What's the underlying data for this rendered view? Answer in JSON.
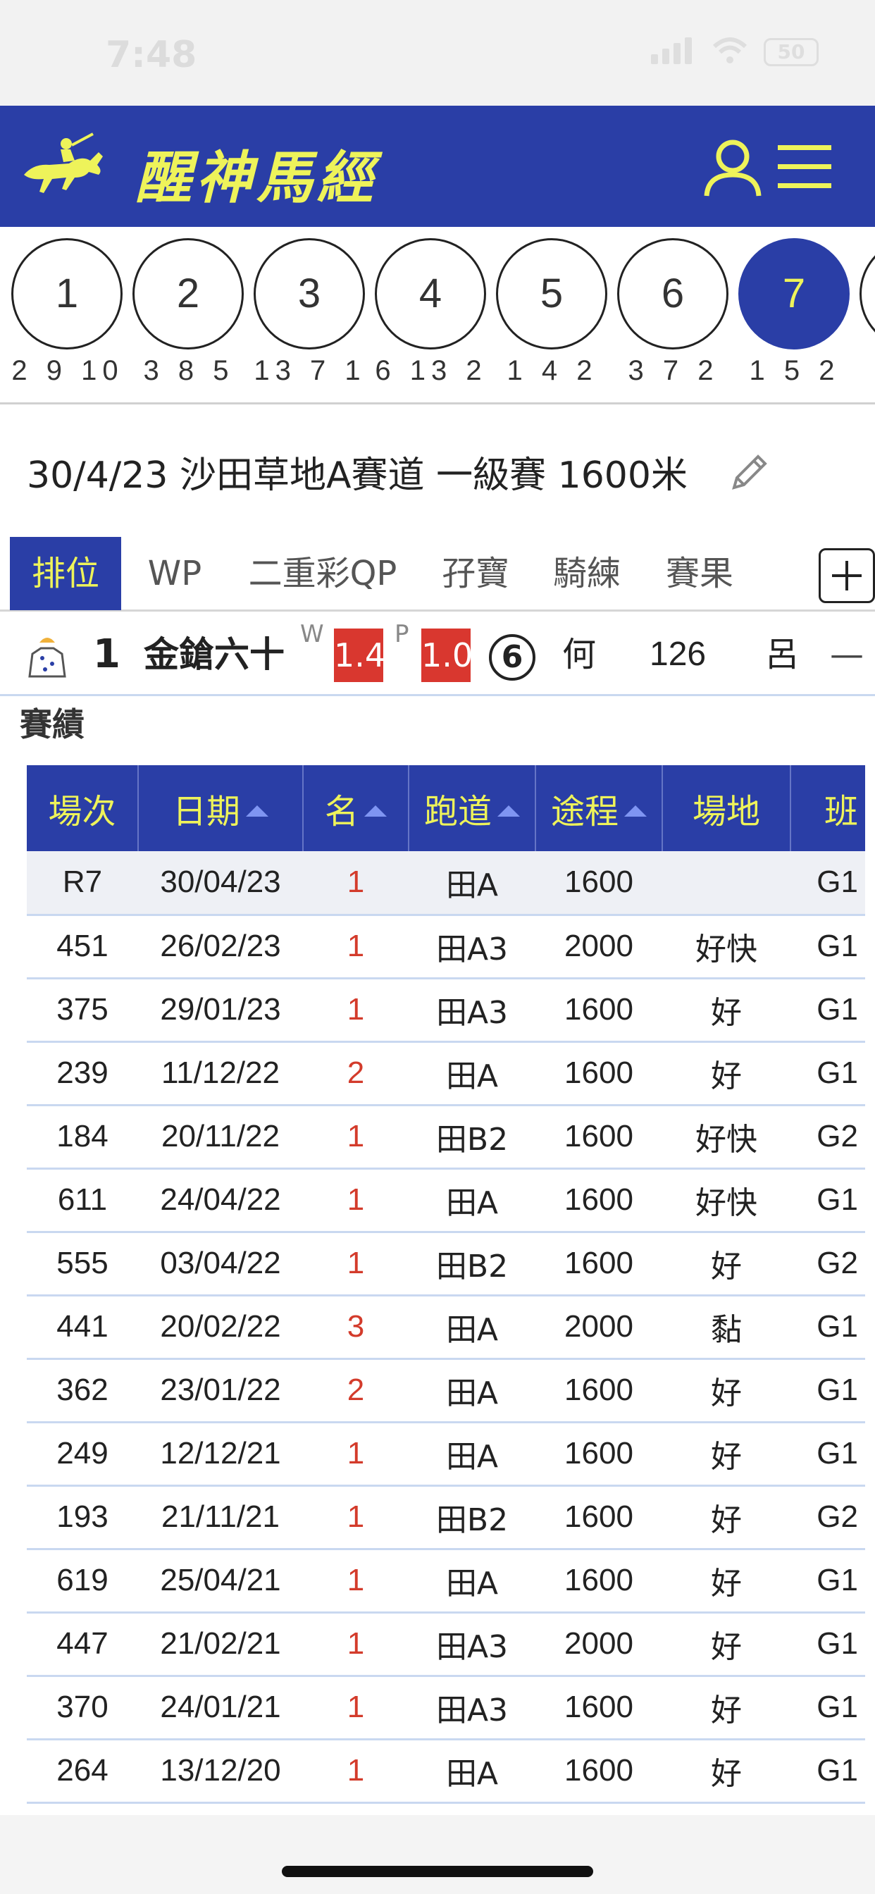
{
  "status_bar": {
    "time": "7:48",
    "battery": "50"
  },
  "header": {
    "title": "醒神馬經"
  },
  "races": [
    {
      "number": "1",
      "sub": "2 9 10"
    },
    {
      "number": "2",
      "sub": "3 8 5"
    },
    {
      "number": "3",
      "sub": "13 7 1"
    },
    {
      "number": "4",
      "sub": "6 13 2"
    },
    {
      "number": "5",
      "sub": "1 4 2"
    },
    {
      "number": "6",
      "sub": "3 7 2"
    },
    {
      "number": "7",
      "sub": "1 5 2"
    }
  ],
  "active_race": "7",
  "race_info": "30/4/23 沙田草地A賽道  一級賽 1600米",
  "tabs": [
    {
      "label": "排位",
      "active": true
    },
    {
      "label": "WP",
      "active": false
    },
    {
      "label": "二重彩QP",
      "active": false
    },
    {
      "label": "孖寶",
      "active": false
    },
    {
      "label": "騎練",
      "active": false
    },
    {
      "label": "賽果",
      "active": false
    }
  ],
  "horse": {
    "number": "1",
    "name": "金鎗六十",
    "win_label": "W",
    "win_odds": "1.4",
    "place_label": "P",
    "place_odds": "1.0",
    "draw": "6",
    "jockey": "何",
    "weight": "126",
    "trainer": "呂",
    "extra": "—"
  },
  "section_title": "賽績",
  "table": {
    "headers": [
      "場次",
      "日期",
      "名",
      "跑道",
      "途程",
      "場地",
      "班"
    ],
    "sortable": [
      false,
      true,
      true,
      true,
      true,
      false,
      false
    ],
    "rows": [
      [
        "R7",
        "30/04/23",
        "1",
        "田A",
        "1600",
        "",
        "G1"
      ],
      [
        "451",
        "26/02/23",
        "1",
        "田A3",
        "2000",
        "好快",
        "G1"
      ],
      [
        "375",
        "29/01/23",
        "1",
        "田A3",
        "1600",
        "好",
        "G1"
      ],
      [
        "239",
        "11/12/22",
        "2",
        "田A",
        "1600",
        "好",
        "G1"
      ],
      [
        "184",
        "20/11/22",
        "1",
        "田B2",
        "1600",
        "好快",
        "G2"
      ],
      [
        "611",
        "24/04/22",
        "1",
        "田A",
        "1600",
        "好快",
        "G1"
      ],
      [
        "555",
        "03/04/22",
        "1",
        "田B2",
        "1600",
        "好",
        "G2"
      ],
      [
        "441",
        "20/02/22",
        "3",
        "田A",
        "2000",
        "黏",
        "G1"
      ],
      [
        "362",
        "23/01/22",
        "2",
        "田A",
        "1600",
        "好",
        "G1"
      ],
      [
        "249",
        "12/12/21",
        "1",
        "田A",
        "1600",
        "好",
        "G1"
      ],
      [
        "193",
        "21/11/21",
        "1",
        "田B2",
        "1600",
        "好",
        "G2"
      ],
      [
        "619",
        "25/04/21",
        "1",
        "田A",
        "1600",
        "好",
        "G1"
      ],
      [
        "447",
        "21/02/21",
        "1",
        "田A3",
        "2000",
        "好",
        "G1"
      ],
      [
        "370",
        "24/01/21",
        "1",
        "田A3",
        "1600",
        "好",
        "G1"
      ],
      [
        "264",
        "13/12/20",
        "1",
        "田A",
        "1600",
        "好",
        "G1"
      ]
    ]
  },
  "colors": {
    "brand_blue": "#2a3ea6",
    "accent_yellow": "#eef35a",
    "odds_red": "#d9372f",
    "place_text_red": "#d33b2b"
  }
}
